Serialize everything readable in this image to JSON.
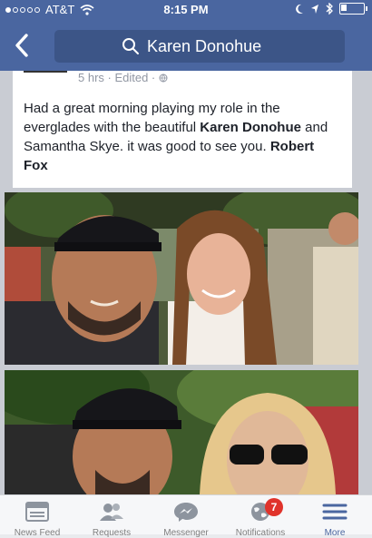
{
  "status_bar": {
    "carrier": "AT&T",
    "time": "8:15 PM"
  },
  "search": {
    "query": "Karen Donohue"
  },
  "post": {
    "meta": "5 hrs · Edited ·",
    "text_parts": [
      "Had a great morning playing my role in the everglades with the beautiful ",
      "Karen Donohue",
      " and Samantha Skye. it was good to see you. ",
      "Robert Fox"
    ]
  },
  "tabs": [
    {
      "label": "News Feed",
      "icon": "news-feed-icon"
    },
    {
      "label": "Requests",
      "icon": "friend-requests-icon"
    },
    {
      "label": "Messenger",
      "icon": "messenger-icon"
    },
    {
      "label": "Notifications",
      "icon": "globe-icon",
      "badge": "7"
    },
    {
      "label": "More",
      "icon": "menu-icon",
      "active": true
    }
  ],
  "colors": {
    "header": "#4a66a0",
    "search_field": "#3c5587",
    "badge": "#e0332b",
    "active_tab": "#4a66a0"
  }
}
